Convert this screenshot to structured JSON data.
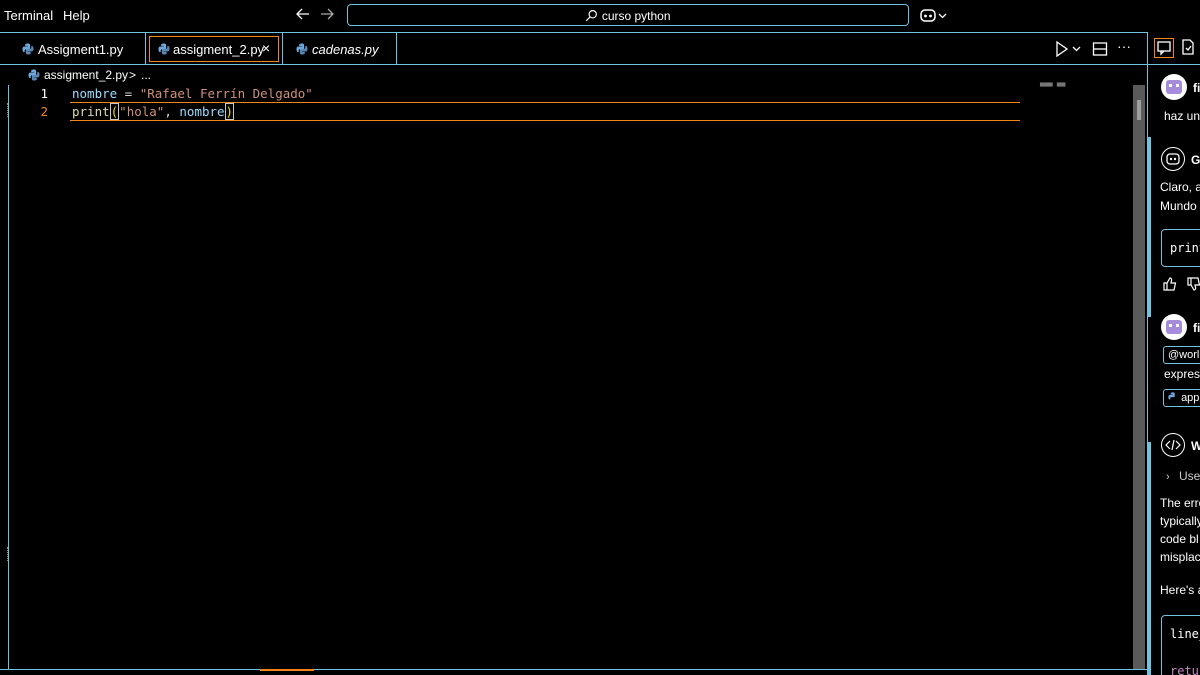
{
  "menu": {
    "terminal": "Terminal",
    "help": "Help"
  },
  "command_center": {
    "label": "curso python"
  },
  "tabs": [
    {
      "label": "Assigment1.py",
      "italic": false,
      "active": false
    },
    {
      "label": "assigment_2.py",
      "italic": false,
      "active": true,
      "close": "×"
    },
    {
      "label": "cadenas.py",
      "italic": true,
      "active": false
    }
  ],
  "editor_actions": {
    "more": "···"
  },
  "breadcrumb": {
    "file": "assigment_2.py",
    "sep": ">",
    "more": "..."
  },
  "code": {
    "lines": [
      {
        "num": "1"
      },
      {
        "num": "2"
      }
    ],
    "line1": {
      "var": "nombre",
      "op": " = ",
      "str": "\"Rafael Ferrín Delgado\""
    },
    "line2": {
      "fn": "print",
      "open": "(",
      "str": "\"hola\"",
      "comma": ", ",
      "var": "nombre",
      "close": ")"
    }
  },
  "chat": {
    "user1_name": "fi",
    "user1_msg": "haz un",
    "bot1_name": "G",
    "bot1_msg_a": "Claro, a",
    "bot1_msg_b": "Mundo",
    "bot1_code": "print",
    "user2_name": "fi",
    "user2_chip": "@worl",
    "user2_msg": "express",
    "user2_file_chip": "app",
    "ws_name": "W",
    "used": "Usec",
    "resp_a": "The erro",
    "resp_b": "typically",
    "resp_c": "code bl",
    "resp_d": "misplac",
    "heres": "Here's a",
    "code2_a": "line_",
    "code2_b": "retur"
  },
  "colors": {
    "accent_border": "#6fc3df",
    "focus": "#f38518",
    "string": "#ce9178",
    "variable": "#9cdcfe",
    "function": "#dcdcaa"
  }
}
